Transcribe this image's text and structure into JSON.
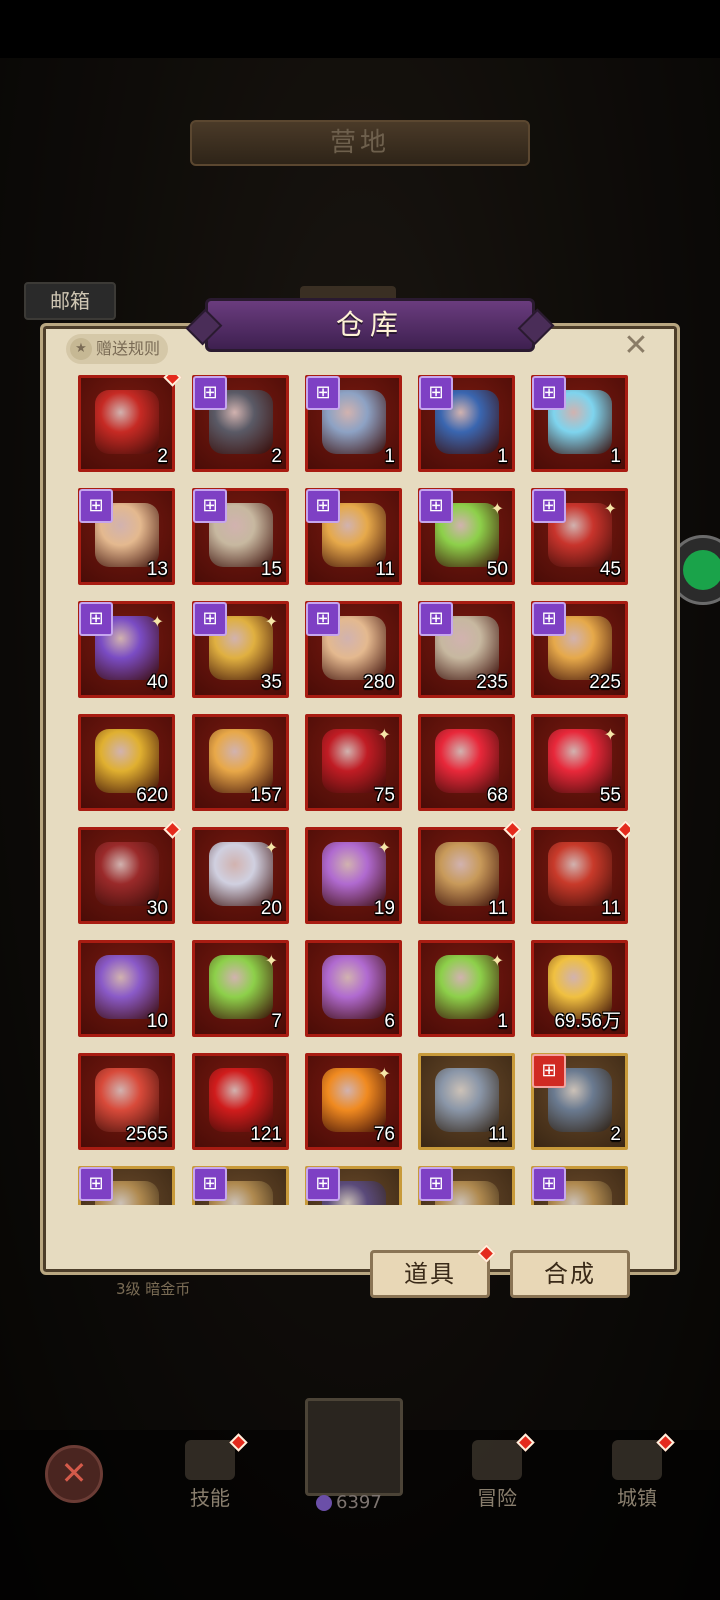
{
  "scene": {
    "camp_title": "营地",
    "mailbox_label": "邮箱",
    "level_hint": "3级 暗金币"
  },
  "panel": {
    "title": "仓库",
    "gift_rules": "赠送规则",
    "close": "✕"
  },
  "buttons": {
    "items": "道具",
    "craft": "合成"
  },
  "nav": {
    "cancel": "✕",
    "skills": "技能",
    "adventure": "冒险",
    "town": "城镇",
    "currency_value": "6397"
  },
  "colors": {
    "gift_badge": "#7e40c4",
    "red_badge": "#d02a22",
    "cell_border": "#a81c12",
    "gold_border": "#c89a3a"
  },
  "items": [
    {
      "icon": "red-energy-chest",
      "count": "2",
      "badge": "",
      "dot": true,
      "spark": false,
      "color": "#c62a24",
      "frame": "red"
    },
    {
      "icon": "chainsaw-sword",
      "count": "2",
      "badge": "gift",
      "dot": false,
      "spark": false,
      "color": "#5a5a66",
      "frame": "red"
    },
    {
      "icon": "robot-hero",
      "count": "1",
      "badge": "gift",
      "dot": false,
      "spark": false,
      "color": "#8da2c4",
      "frame": "red"
    },
    {
      "icon": "twin-blades",
      "count": "1",
      "badge": "gift",
      "dot": false,
      "spark": false,
      "color": "#3a66b0",
      "frame": "red"
    },
    {
      "icon": "ice-wings",
      "count": "1",
      "badge": "gift",
      "dot": false,
      "spark": false,
      "color": "#7ed4ee",
      "frame": "red"
    },
    {
      "icon": "dark-hair-hero",
      "count": "13",
      "badge": "gift",
      "dot": false,
      "spark": false,
      "color": "#e4b98f",
      "frame": "red"
    },
    {
      "icon": "hooded-old-man",
      "count": "15",
      "badge": "gift",
      "dot": false,
      "spark": false,
      "color": "#c7b8a0",
      "frame": "red"
    },
    {
      "icon": "tiger-hood-pig",
      "count": "11",
      "badge": "gift",
      "dot": false,
      "spark": false,
      "color": "#e6a94a",
      "frame": "red"
    },
    {
      "icon": "green-orb-staff",
      "count": "50",
      "badge": "gift",
      "dot": false,
      "spark": true,
      "color": "#8dd04a",
      "frame": "red"
    },
    {
      "icon": "ruby-hammer",
      "count": "45",
      "badge": "gift",
      "dot": false,
      "spark": true,
      "color": "#c8342c",
      "frame": "red"
    },
    {
      "icon": "purple-spear",
      "count": "40",
      "badge": "gift",
      "dot": false,
      "spark": true,
      "color": "#7a4cc4",
      "frame": "red"
    },
    {
      "icon": "golden-crown",
      "count": "35",
      "badge": "gift",
      "dot": false,
      "spark": true,
      "color": "#e0b040",
      "frame": "red"
    },
    {
      "icon": "dark-hair-hero",
      "count": "280",
      "badge": "gift",
      "dot": false,
      "spark": false,
      "color": "#e4b98f",
      "frame": "red"
    },
    {
      "icon": "hooded-old-man",
      "count": "235",
      "badge": "gift",
      "dot": false,
      "spark": false,
      "color": "#c7b8a0",
      "frame": "red"
    },
    {
      "icon": "tiger-hood-pig",
      "count": "225",
      "badge": "gift",
      "dot": false,
      "spark": false,
      "color": "#e6a94a",
      "frame": "red"
    },
    {
      "icon": "golden-mask",
      "count": "620",
      "badge": "",
      "dot": false,
      "spark": false,
      "color": "#e0b030",
      "frame": "red"
    },
    {
      "icon": "golden-feather",
      "count": "157",
      "badge": "",
      "dot": false,
      "spark": false,
      "color": "#e8a848",
      "frame": "red"
    },
    {
      "icon": "red-crystal",
      "count": "75",
      "badge": "",
      "dot": false,
      "spark": true,
      "color": "#c01c24",
      "frame": "red"
    },
    {
      "icon": "red-potion",
      "count": "68",
      "badge": "",
      "dot": false,
      "spark": false,
      "color": "#e8283a",
      "frame": "red"
    },
    {
      "icon": "red-potion",
      "count": "55",
      "badge": "",
      "dot": false,
      "spark": true,
      "color": "#e8283a",
      "frame": "red"
    },
    {
      "icon": "demon-armor",
      "count": "30",
      "badge": "",
      "dot": true,
      "spark": false,
      "color": "#9a2a2a",
      "frame": "red"
    },
    {
      "icon": "horned-helmet-hero",
      "count": "20",
      "badge": "",
      "dot": false,
      "spark": true,
      "color": "#d0d0e0",
      "frame": "red"
    },
    {
      "icon": "rainbow-crystal",
      "count": "19",
      "badge": "",
      "dot": false,
      "spark": true,
      "color": "#b06ad0",
      "frame": "red"
    },
    {
      "icon": "skull-chest",
      "count": "11",
      "badge": "",
      "dot": true,
      "spark": false,
      "color": "#c89a5a",
      "frame": "red"
    },
    {
      "icon": "skull-bag",
      "count": "11",
      "badge": "",
      "dot": true,
      "spark": false,
      "color": "#c83a2a",
      "frame": "red"
    },
    {
      "icon": "star-shield",
      "count": "10",
      "badge": "",
      "dot": false,
      "spark": false,
      "color": "#8a5ac8",
      "frame": "red"
    },
    {
      "icon": "green-orb-staff",
      "count": "7",
      "badge": "",
      "dot": false,
      "spark": true,
      "color": "#8dd04a",
      "frame": "red"
    },
    {
      "icon": "rainbow-crystal",
      "count": "6",
      "badge": "",
      "dot": false,
      "spark": false,
      "color": "#b06ad0",
      "frame": "red"
    },
    {
      "icon": "green-orb-staff",
      "count": "1",
      "badge": "",
      "dot": false,
      "spark": true,
      "color": "#8dd04a",
      "frame": "red"
    },
    {
      "icon": "gold-crystal",
      "count": "69.56万",
      "badge": "",
      "dot": false,
      "spark": false,
      "color": "#f0c040",
      "frame": "red"
    },
    {
      "icon": "ruby-amulet",
      "count": "2565",
      "badge": "",
      "dot": false,
      "spark": false,
      "color": "#d84a3a",
      "frame": "red"
    },
    {
      "icon": "ruby-gem",
      "count": "121",
      "badge": "",
      "dot": false,
      "spark": false,
      "color": "#d01c1c",
      "frame": "red"
    },
    {
      "icon": "orange-potion",
      "count": "76",
      "badge": "",
      "dot": false,
      "spark": true,
      "color": "#f08a20",
      "frame": "red"
    },
    {
      "icon": "iron-key",
      "count": "11",
      "badge": "",
      "dot": false,
      "spark": false,
      "color": "#8a96a8",
      "frame": "gold"
    },
    {
      "icon": "iron-chest",
      "count": "2",
      "badge": "red-gift",
      "dot": false,
      "spark": false,
      "color": "#6a7a90",
      "frame": "gold"
    },
    {
      "icon": "treasure-item",
      "count": "",
      "badge": "gift",
      "dot": false,
      "spark": false,
      "color": "#b08a50",
      "frame": "gold"
    },
    {
      "icon": "treasure-item",
      "count": "",
      "badge": "gift",
      "dot": false,
      "spark": false,
      "color": "#b08a50",
      "frame": "gold"
    },
    {
      "icon": "treasure-item",
      "count": "",
      "badge": "gift",
      "dot": false,
      "spark": false,
      "color": "#5a4a7a",
      "frame": "gold"
    },
    {
      "icon": "treasure-item",
      "count": "",
      "badge": "gift",
      "dot": false,
      "spark": false,
      "color": "#b08a50",
      "frame": "gold"
    },
    {
      "icon": "treasure-item",
      "count": "",
      "badge": "gift",
      "dot": false,
      "spark": false,
      "color": "#b08a50",
      "frame": "gold"
    }
  ]
}
